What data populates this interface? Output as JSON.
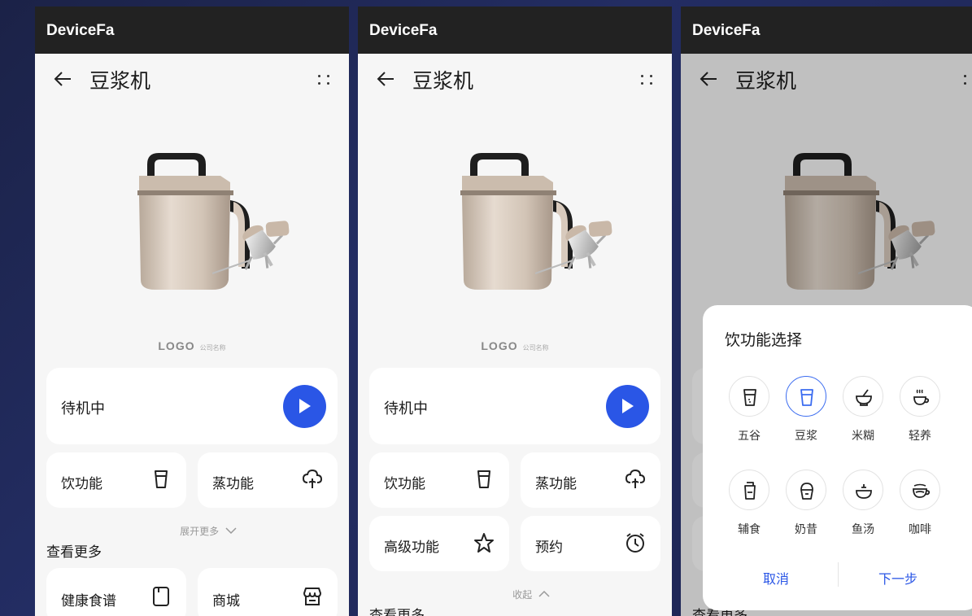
{
  "app": {
    "statusbar_title": "DeviceFa",
    "page_title": "豆浆机"
  },
  "brand": {
    "logo": "LOGO",
    "company": "公司名称"
  },
  "status": {
    "label": "待机中"
  },
  "functions": {
    "drink": "饮功能",
    "steam": "蒸功能",
    "advanced": "高级功能",
    "schedule": "预约"
  },
  "expand_label": "展开更多",
  "collapse_label": "收起",
  "more": {
    "title": "查看更多",
    "recipes": "健康食谱",
    "mall": "商城"
  },
  "dialog": {
    "title": "饮功能选择",
    "options": [
      "五谷",
      "豆浆",
      "米糊",
      "轻养",
      "辅食",
      "奶昔",
      "鱼汤",
      "咖啡"
    ],
    "selected": "豆浆",
    "cancel": "取消",
    "next": "下一步"
  },
  "colors": {
    "accent": "#2a56e6",
    "statusbar": "#222222",
    "background": "#f6f6f6"
  }
}
